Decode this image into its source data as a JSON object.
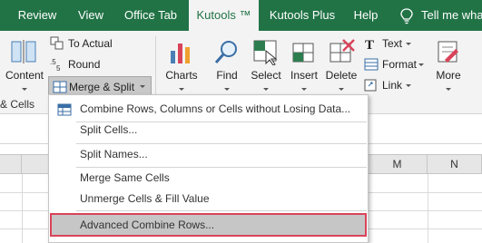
{
  "ribbon_tabs": [
    "Review",
    "View",
    "Office Tab",
    "Kutools ™",
    "Kutools Plus",
    "Help"
  ],
  "tell_me": "Tell me wha",
  "ribbon": {
    "content_label": "Content",
    "to_actual": "To Actual",
    "round": "Round",
    "merge_split": "Merge & Split",
    "charts": "Charts",
    "find": "Find",
    "select": "Select",
    "insert": "Insert",
    "delete": "Delete",
    "text": "Text",
    "format": "Format",
    "link": "Link",
    "more": "More",
    "group_label": "& Cells"
  },
  "columns": [
    "M",
    "N"
  ],
  "menu": {
    "items": [
      "Combine Rows, Columns or Cells without Losing Data...",
      "Split Cells...",
      "Split Names...",
      "Merge Same Cells",
      "Unmerge Cells & Fill Value",
      "Advanced Combine Rows..."
    ]
  },
  "colors": {
    "accent": "#217346",
    "highlight_border": "#d9435a",
    "highlight_bg": "#c6c6c6"
  }
}
